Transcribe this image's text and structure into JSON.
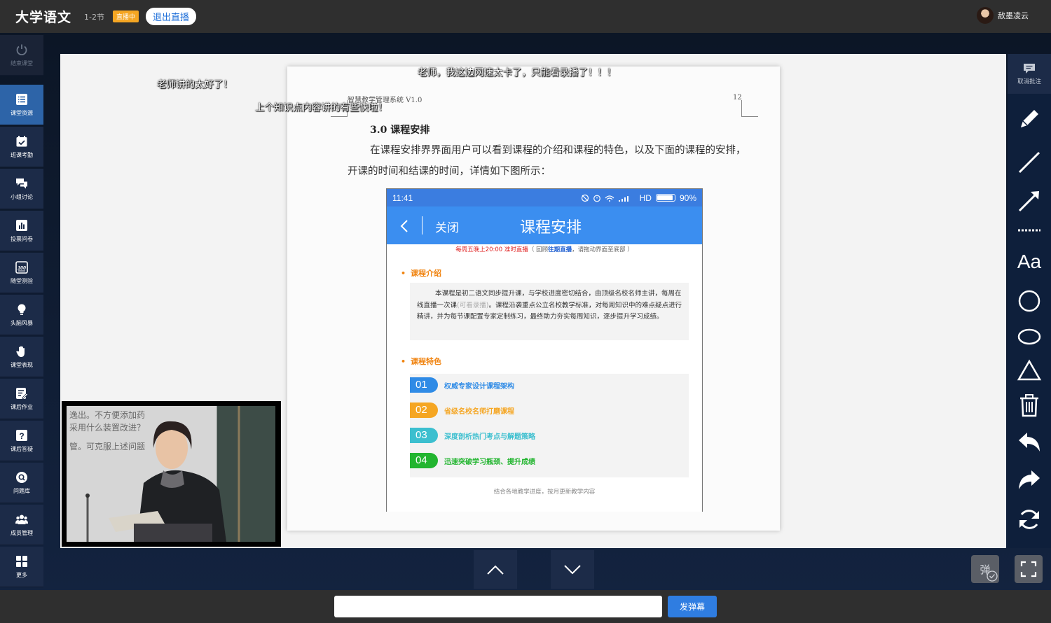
{
  "topbar": {
    "title": "大学语文",
    "session": "1-2节",
    "live_badge": "直播中",
    "exit_label": "退出直播",
    "username": "敌墨凌云"
  },
  "sidebar": {
    "end_class": "结束课堂",
    "items": [
      {
        "label": "课堂资源",
        "icon": "list-icon",
        "active": true
      },
      {
        "label": "班课考勤",
        "icon": "calendar-check-icon"
      },
      {
        "label": "小组讨论",
        "icon": "chat-icon"
      },
      {
        "label": "投票问卷",
        "icon": "bar-chart-icon"
      },
      {
        "label": "随堂测验",
        "icon": "score-100-icon"
      },
      {
        "label": "头脑风暴",
        "icon": "lightbulb-icon"
      },
      {
        "label": "课堂表现",
        "icon": "hand-icon"
      },
      {
        "label": "课后作业",
        "icon": "edit-document-icon"
      },
      {
        "label": "课后答疑",
        "icon": "question-icon"
      },
      {
        "label": "问题库",
        "icon": "search-question-icon"
      },
      {
        "label": "成员管理",
        "icon": "group-icon"
      },
      {
        "label": "更多",
        "icon": "grid-icon"
      }
    ]
  },
  "document": {
    "header": "智慧教学管理系统 V1.0",
    "page_number": "12",
    "section_title": "3.0  课程安排",
    "paragraph": "在课程安排界界面用户可以看到课程的介绍和课程的特色，以及下面的课程的安排，开课的时间和结课的时间，详情如下图所示："
  },
  "phone": {
    "time": "11:41",
    "status_right": "HD",
    "battery": "90%",
    "close_label": "关闭",
    "title": "课程安排",
    "notice_red": "每周五晚上20:00 准时直播",
    "notice_gray_1": "（ 回顾",
    "notice_blue": "往期直播",
    "notice_gray_2": "，请拖动界面至底部 ）",
    "intro_title": "课程介绍",
    "intro_1": "本课程是初二语文同步提升课，与学校进度密切结合，由顶级名校名师主讲，每周在线直播一次课",
    "intro_hl": "(可看录播)",
    "intro_2": "。课程沿袭重点公立名校教学标准，对每周知识中的难点疑点进行精讲，并为每节课配置专家定制练习，最终助力夯实每周知识，逐步提升学习成绩。",
    "features_title": "课程特色",
    "features": [
      {
        "num": "01",
        "text": "权威专家设计课程架构",
        "color": "#2f8be6"
      },
      {
        "num": "02",
        "text": "省级名校名师打磨课程",
        "color": "#f5a623"
      },
      {
        "num": "03",
        "text": "深度剖析热门考点与解题策略",
        "color": "#3cbfcf"
      },
      {
        "num": "04",
        "text": "迅速突破学习瓶颈、提升成绩",
        "color": "#22b52f"
      }
    ],
    "footer": "结合各地教学进度，按月更新教学内容"
  },
  "danmaku": [
    "老师，我这边网速太卡了，只能看录播了！！！",
    "老师讲的太好了！",
    "上个知识点内容讲的有些快啦！"
  ],
  "video": {
    "board_text_1": "逸出。不方便添加药",
    "board_text_2": "采用什么装置改进？",
    "board_text_3": "管。可克服上述问题"
  },
  "rightbar": {
    "cancel_note": "取消批注",
    "tools": [
      "pen-icon",
      "line-icon",
      "arrow-icon",
      "dotted-line-icon",
      "text-icon",
      "circle-icon",
      "ellipse-icon",
      "triangle-icon",
      "trash-icon",
      "undo-icon",
      "redo-icon",
      "refresh-icon"
    ],
    "text_tool_label": "Aa"
  },
  "bottom": {
    "danmaku_toggle": "弹",
    "input_placeholder": "",
    "send_label": "发弹幕"
  }
}
